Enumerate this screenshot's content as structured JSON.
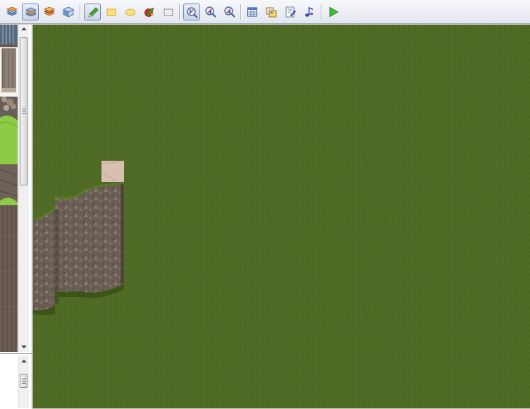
{
  "toolbar": {
    "groups": [
      {
        "name": "layers",
        "buttons": [
          {
            "id": "layer-1",
            "icon": "layer-1-icon",
            "active": false
          },
          {
            "id": "layer-2",
            "icon": "layer-2-icon",
            "active": true
          },
          {
            "id": "layer-3",
            "icon": "layer-3-icon",
            "active": false
          },
          {
            "id": "event-layer",
            "icon": "event-layer-icon",
            "active": false
          }
        ]
      },
      {
        "name": "drawing-tools",
        "buttons": [
          {
            "id": "pencil",
            "icon": "pencil-icon",
            "active": true
          },
          {
            "id": "rectangle",
            "icon": "rectangle-icon",
            "active": false
          },
          {
            "id": "ellipse",
            "icon": "ellipse-icon",
            "active": false
          },
          {
            "id": "fill",
            "icon": "fill-icon",
            "active": false
          },
          {
            "id": "select",
            "icon": "select-icon",
            "active": false
          }
        ]
      },
      {
        "name": "zoom",
        "buttons": [
          {
            "id": "zoom-1-1",
            "icon": "zoom-1-1-icon",
            "active": true
          },
          {
            "id": "zoom-1-2",
            "icon": "zoom-1-2-icon",
            "active": false
          },
          {
            "id": "zoom-1-4",
            "icon": "zoom-1-4-icon",
            "active": false
          }
        ]
      },
      {
        "name": "databases",
        "buttons": [
          {
            "id": "database",
            "icon": "database-icon",
            "active": false
          },
          {
            "id": "materialbase",
            "icon": "materialbase-icon",
            "active": false
          },
          {
            "id": "script-editor",
            "icon": "script-editor-icon",
            "active": false
          },
          {
            "id": "sound-test",
            "icon": "sound-test-icon",
            "active": false
          }
        ]
      },
      {
        "name": "playtest",
        "buttons": [
          {
            "id": "playtest",
            "icon": "play-icon",
            "active": false
          }
        ]
      }
    ]
  },
  "tileset_panel": {
    "scroll_position": 0.0,
    "visible_fraction": 0.45
  },
  "lower_panel": {
    "scroll_position": 0.5
  },
  "colors": {
    "grass": "#4e6a24",
    "grass_light": "#5a7a2a",
    "cliff": "#6e6258",
    "cliff_dark": "#4a4038",
    "sand": "#d8c0b0",
    "bright_grass": "#8ccc44",
    "accent": "#6f86b0"
  }
}
